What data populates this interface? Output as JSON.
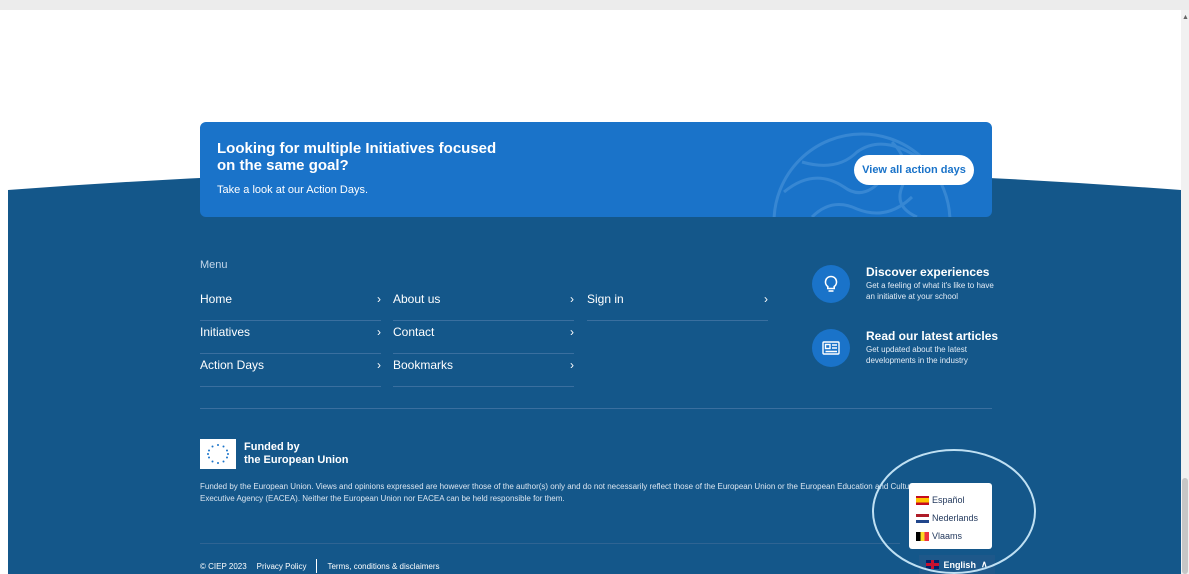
{
  "banner": {
    "title": "Looking for multiple Initiatives focused on the same goal?",
    "subtitle": "Take a look at our Action Days.",
    "button_label": "View all action days"
  },
  "menu": {
    "heading": "Menu",
    "columns": [
      [
        {
          "label": "Home"
        },
        {
          "label": "Initiatives"
        },
        {
          "label": "Action Days"
        }
      ],
      [
        {
          "label": "About us"
        },
        {
          "label": "Contact"
        },
        {
          "label": "Bookmarks"
        }
      ],
      [
        {
          "label": "Sign in"
        }
      ]
    ]
  },
  "features": [
    {
      "title": "Discover experiences",
      "description": "Get a feeling of what it's like to have an initiative at your school",
      "icon": "lightbulb-icon"
    },
    {
      "title": "Read our latest articles",
      "description": "Get updated about the latest developments in the industry",
      "icon": "newspaper-icon"
    }
  ],
  "eu": {
    "funded_line1": "Funded by",
    "funded_line2": "the European Union",
    "disclaimer": "Funded by the European Union. Views and opinions expressed are however those of the author(s) only and do not necessarily reflect those of the European Union or the European Education and Culture Executive Agency (EACEA). Neither the European Union nor EACEA can be held responsible for them."
  },
  "bottom": {
    "copyright": "© CIEP 2023",
    "privacy": "Privacy Policy",
    "terms": "Terms, conditions & disclaimers"
  },
  "language": {
    "options": [
      {
        "label": "Español",
        "flag": "es"
      },
      {
        "label": "Nederlands",
        "flag": "nl"
      },
      {
        "label": "Vlaams",
        "flag": "be"
      }
    ],
    "current": "English"
  },
  "colors": {
    "footer_bg": "#14578a",
    "banner_bg": "#1a73c9",
    "accent": "#1a73c9"
  }
}
